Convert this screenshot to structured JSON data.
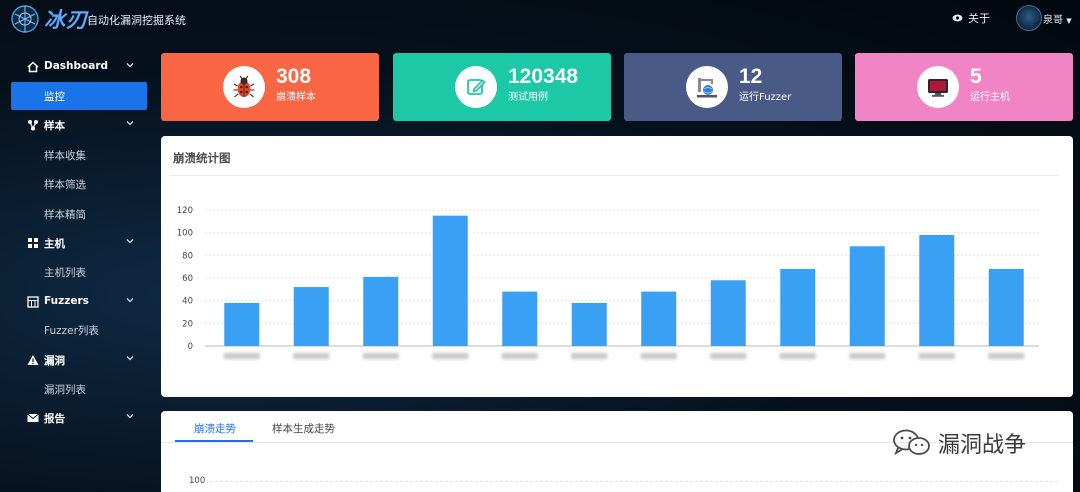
{
  "header": {
    "brand": "冰刃",
    "subtitle": "自动化漏洞挖掘系统",
    "about_label": "关于",
    "user_name": "泉哥"
  },
  "sidebar": {
    "groups": [
      {
        "label": "Dashboard",
        "icon": "home-icon",
        "items": [
          "监控"
        ]
      },
      {
        "label": "样本",
        "icon": "branch-icon",
        "items": [
          "样本收集",
          "样本筛选",
          "样本精简"
        ]
      },
      {
        "label": "主机",
        "icon": "grid-icon",
        "items": [
          "主机列表"
        ]
      },
      {
        "label": "Fuzzers",
        "icon": "calculator-icon",
        "items": [
          "Fuzzer列表"
        ]
      },
      {
        "label": "漏洞",
        "icon": "warning-icon",
        "items": [
          "漏洞列表"
        ]
      },
      {
        "label": "报告",
        "icon": "envelope-icon",
        "items": []
      }
    ],
    "active_item": "监控"
  },
  "stats": [
    {
      "value": "308",
      "label": "崩溃样本",
      "icon": "bug-icon",
      "color": "#fa6544"
    },
    {
      "value": "120348",
      "label": "测试用例",
      "icon": "edit-icon",
      "color": "#1cc8a6"
    },
    {
      "value": "12",
      "label": "运行Fuzzer",
      "icon": "fuzzer-machine-icon",
      "color": "#4a5a87"
    },
    {
      "value": "5",
      "label": "运行主机",
      "icon": "monitor-icon",
      "color": "#f084c4"
    }
  ],
  "crash_panel": {
    "title": "崩溃统计图"
  },
  "chart_data": {
    "type": "bar",
    "title": "崩溃统计图",
    "categories": [
      "",
      "",
      "",
      "",
      "",
      "",
      "",
      "",
      "",
      "",
      "",
      ""
    ],
    "values": [
      38,
      52,
      61,
      115,
      48,
      38,
      48,
      58,
      68,
      88,
      98,
      68
    ],
    "ylim": [
      0,
      120
    ],
    "yticks": [
      0,
      20,
      40,
      60,
      80,
      100,
      120
    ],
    "bar_color": "#3aa0f3",
    "grid": true,
    "legend": "none"
  },
  "trend_panel": {
    "tabs": [
      "崩溃走势",
      "样本生成走势"
    ],
    "active_tab": "崩溃走势",
    "visible_tick": "100"
  },
  "watermark": {
    "text": "漏洞战争",
    "icon": "wechat-icon"
  }
}
